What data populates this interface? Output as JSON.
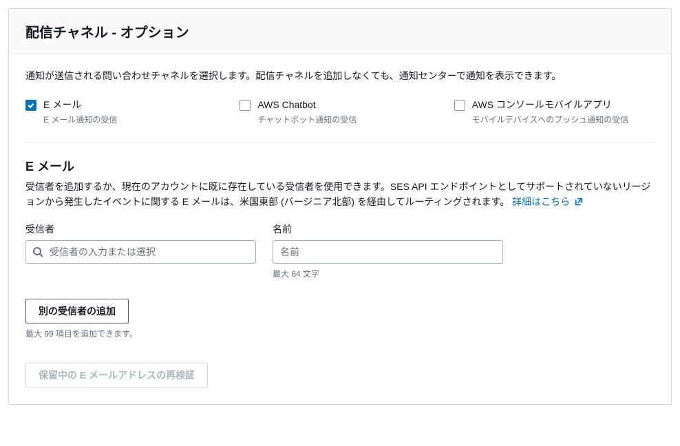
{
  "header": {
    "title": "配信チャネル - オプション"
  },
  "description": "通知が送信される問い合わせチャネルを選択します。配信チャネルを追加しなくても、通知センターで通知を表示できます。",
  "channels": {
    "email": {
      "label": "E メール",
      "sub": "E メール通知の受信",
      "checked": true
    },
    "chatbot": {
      "label": "AWS Chatbot",
      "sub": "チャットボット通知の受信",
      "checked": false
    },
    "mobile": {
      "label": "AWS コンソールモバイルアプリ",
      "sub": "モバイルデバイスへのプッシュ通知の受信",
      "checked": false
    }
  },
  "emailSection": {
    "title": "E メール",
    "description": "受信者を追加するか、現在のアカウントに既に存在している受信者を使用できます。SES API エンドポイントとしてサポートされていないリージョンから発生したイベントに関する E メールは、米国東部 (バージニア北部) を経由してルーティングされます。 ",
    "linkText": "詳細はこちら ",
    "recipientLabel": "受信者",
    "recipientPlaceholder": "受信者の入力または選択",
    "nameLabel": "名前",
    "namePlaceholder": "名前",
    "nameHelper": "最大 64 文字",
    "addButton": "別の受信者の追加",
    "addHelper": "最大 99 項目を追加できます。",
    "revalidateButton": "保留中の E メールアドレスの再検証"
  }
}
